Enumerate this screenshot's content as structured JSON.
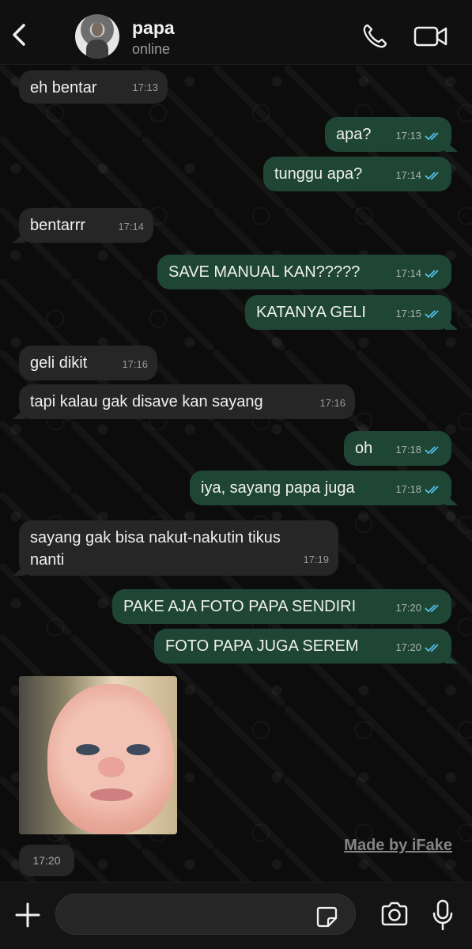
{
  "header": {
    "contact_name": "papa",
    "status": "online"
  },
  "messages": [
    {
      "dir": "in",
      "text": "eh bentar",
      "time": "17:13"
    },
    {
      "dir": "out",
      "text": "apa?",
      "time": "17:13"
    },
    {
      "dir": "out",
      "text": "tunggu apa?",
      "time": "17:14"
    },
    {
      "dir": "in",
      "text": "bentarrr",
      "time": "17:14"
    },
    {
      "dir": "out",
      "text": "SAVE MANUAL KAN?????",
      "time": "17:14"
    },
    {
      "dir": "out",
      "text": "KATANYA GELI",
      "time": "17:15"
    },
    {
      "dir": "in",
      "text": "geli dikit",
      "time": "17:16"
    },
    {
      "dir": "in",
      "text": "tapi kalau gak disave kan sayang",
      "time": "17:16"
    },
    {
      "dir": "out",
      "text": "oh",
      "time": "17:18"
    },
    {
      "dir": "out",
      "text": "iya, sayang papa juga",
      "time": "17:18"
    },
    {
      "dir": "in",
      "text": "sayang gak bisa nakut-nakutin tikus nanti",
      "time": "17:19"
    },
    {
      "dir": "out",
      "text": "PAKE AJA FOTO PAPA SENDIRI",
      "time": "17:20"
    },
    {
      "dir": "out",
      "text": "FOTO PAPA JUGA SEREM",
      "time": "17:20"
    }
  ],
  "photo_message": {
    "time": "17:20"
  },
  "watermark": "Made by iFake",
  "composer": {
    "placeholder": ""
  },
  "colors": {
    "incoming_bubble": "#262626",
    "outgoing_bubble": "#1f4634",
    "read_ticks": "#53bdeb"
  },
  "icons": [
    "back-chevron-icon",
    "phone-icon",
    "video-camera-icon",
    "plus-icon",
    "sticker-icon",
    "camera-icon",
    "microphone-icon",
    "double-check-icon"
  ]
}
